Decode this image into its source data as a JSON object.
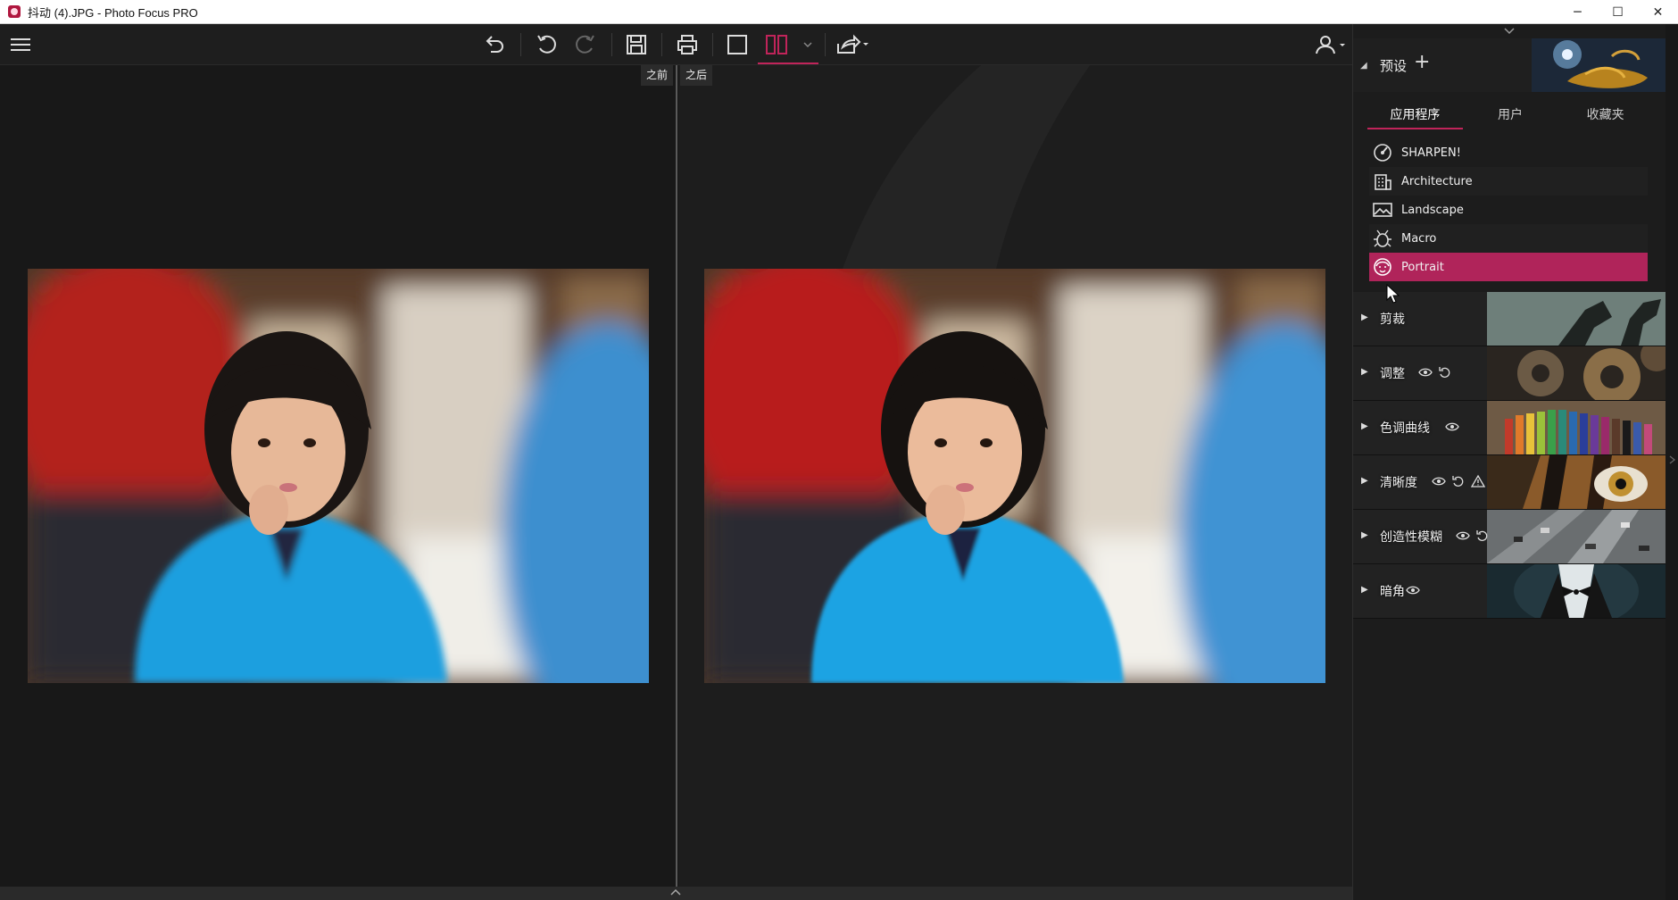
{
  "window": {
    "title": "抖动 (4).JPG - Photo Focus PRO",
    "minimize": "─",
    "maximize": "☐",
    "close": "✕"
  },
  "toolbar": {
    "icons": [
      "menu-icon",
      "undo-all-icon",
      "undo-icon",
      "redo-icon",
      "save-icon",
      "print-icon",
      "single-view-icon",
      "split-view-icon",
      "share-icon",
      "user-icon"
    ]
  },
  "compare": {
    "before_label": "之前",
    "after_label": "之后"
  },
  "panel": {
    "presets_title": "预设",
    "tabs": [
      {
        "label": "应用程序",
        "active": true
      },
      {
        "label": "用户",
        "active": false
      },
      {
        "label": "收藏夹",
        "active": false
      }
    ],
    "preset_items": [
      {
        "label": "SHARPEN!",
        "icon": "sharpen-icon",
        "active": false
      },
      {
        "label": "Architecture",
        "icon": "architecture-icon",
        "active": false
      },
      {
        "label": "Landscape",
        "icon": "landscape-icon",
        "active": false
      },
      {
        "label": "Macro",
        "icon": "macro-icon",
        "active": false
      },
      {
        "label": "Portrait",
        "icon": "portrait-icon",
        "active": true
      }
    ],
    "sections": [
      {
        "label": "剪裁",
        "icons": []
      },
      {
        "label": "调整",
        "icons": [
          "eye-icon",
          "reset-icon"
        ]
      },
      {
        "label": "色调曲线",
        "icons": [
          "eye-icon"
        ]
      },
      {
        "label": "清晰度",
        "icons": [
          "eye-icon",
          "reset-icon",
          "warning-icon"
        ]
      },
      {
        "label": "创造性模糊",
        "icons": [
          "eye-icon",
          "reset-icon"
        ]
      },
      {
        "label": "暗角",
        "icons": [
          "eye-icon"
        ]
      }
    ]
  },
  "colors": {
    "accent": "#c0245a",
    "active_preset": "#b0245a"
  }
}
